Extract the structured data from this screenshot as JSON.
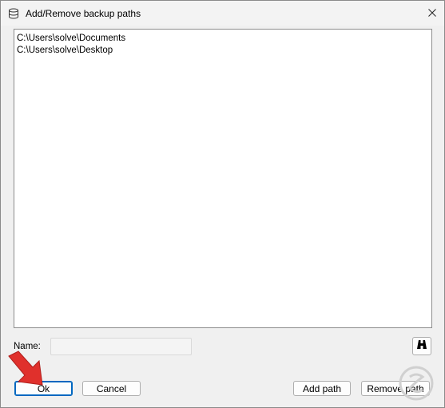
{
  "window": {
    "title": "Add/Remove backup paths",
    "close_glyph": "✕"
  },
  "paths": [
    "C:\\Users\\solve\\Documents",
    "C:\\Users\\solve\\Desktop"
  ],
  "name_field": {
    "label": "Name:",
    "value": ""
  },
  "buttons": {
    "ok": "Ok",
    "cancel": "Cancel",
    "add_path": "Add path",
    "remove_path": "Remove path"
  },
  "icons": {
    "app": "database-icon",
    "browse": "binoculars-icon",
    "close": "close-icon"
  },
  "watermark": {
    "text": "SOLVETIC"
  },
  "colors": {
    "accent": "#0067c0",
    "annotation_arrow": "#e0302c"
  }
}
